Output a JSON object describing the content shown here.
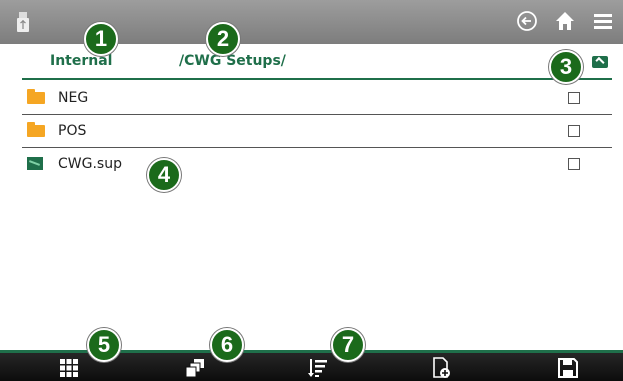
{
  "topbar": {
    "usb_icon": "usb-icon",
    "back_icon": "back-arrow-icon",
    "home_icon": "home-icon",
    "menu_icon": "hamburger-menu-icon"
  },
  "path": {
    "location": "Internal",
    "folder": "/CWG Setups/"
  },
  "files": [
    {
      "name": "NEG",
      "type": "folder"
    },
    {
      "name": "POS",
      "type": "folder"
    },
    {
      "name": "CWG.sup",
      "type": "file"
    }
  ],
  "callouts": [
    "1",
    "2",
    "3",
    "4",
    "5",
    "6",
    "7"
  ],
  "toolbar": {
    "buttons": [
      "grid-view-icon",
      "copy-icon",
      "sort-icon",
      "new-file-icon",
      "save-icon"
    ]
  },
  "colors": {
    "accent": "#1f6f4a",
    "folder": "#f5a623",
    "callout": "#1b6a1b"
  }
}
